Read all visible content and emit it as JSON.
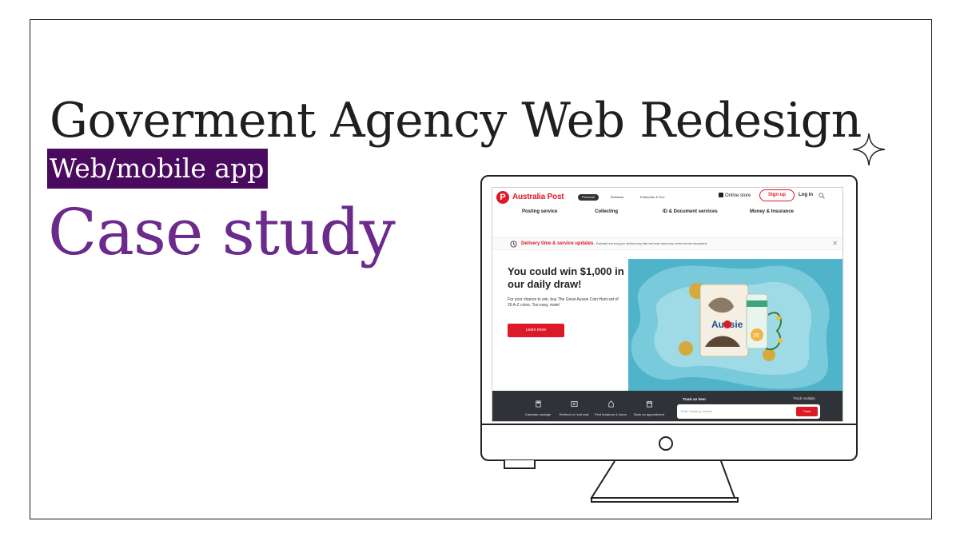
{
  "slide": {
    "title": "Goverment Agency Web Redesign",
    "subtitle": "Web/mobile app",
    "tagline": "Case study",
    "colors": {
      "subtitle_bg": "#4a0a5e",
      "tagline": "#6b2a8c",
      "text": "#1f1f1f"
    }
  },
  "site": {
    "brand": "Australia Post",
    "accent": "#dc1928",
    "segments": [
      "Personal",
      "Business",
      "Enterprise & Gov"
    ],
    "online_store": "Online store",
    "signup": "Sign up",
    "login": "Log in",
    "nav": [
      "Posting service",
      "Collecting",
      "ID & Document services",
      "Money & Insurance"
    ],
    "alert": {
      "title": "Delivery time & service updates",
      "text": "– Estimate how long your delivery may take and learn about any current service disruptions."
    },
    "hero": {
      "heading": "You could win $1,000 in our daily draw!",
      "body": "For your chance to win, buy The Great Aussie Coin Hunt set of 26 A-Z coins. Too easy, mate!",
      "cta": "Learn more",
      "bg": "#4fb3c9",
      "coin_set_text": "Aussie",
      "coin_tag": "26"
    },
    "tools": [
      {
        "label": "Calculate postage",
        "icon": "calculator-icon"
      },
      {
        "label": "Redirect or hold mail",
        "icon": "mail-redirect-icon"
      },
      {
        "label": "Find locations & hours",
        "icon": "location-icon"
      },
      {
        "label": "Book an appointment",
        "icon": "calendar-icon"
      }
    ],
    "track": {
      "label": "Track an item",
      "multiple": "Track multiple",
      "placeholder": "Enter tracking number",
      "button": "Track"
    }
  }
}
